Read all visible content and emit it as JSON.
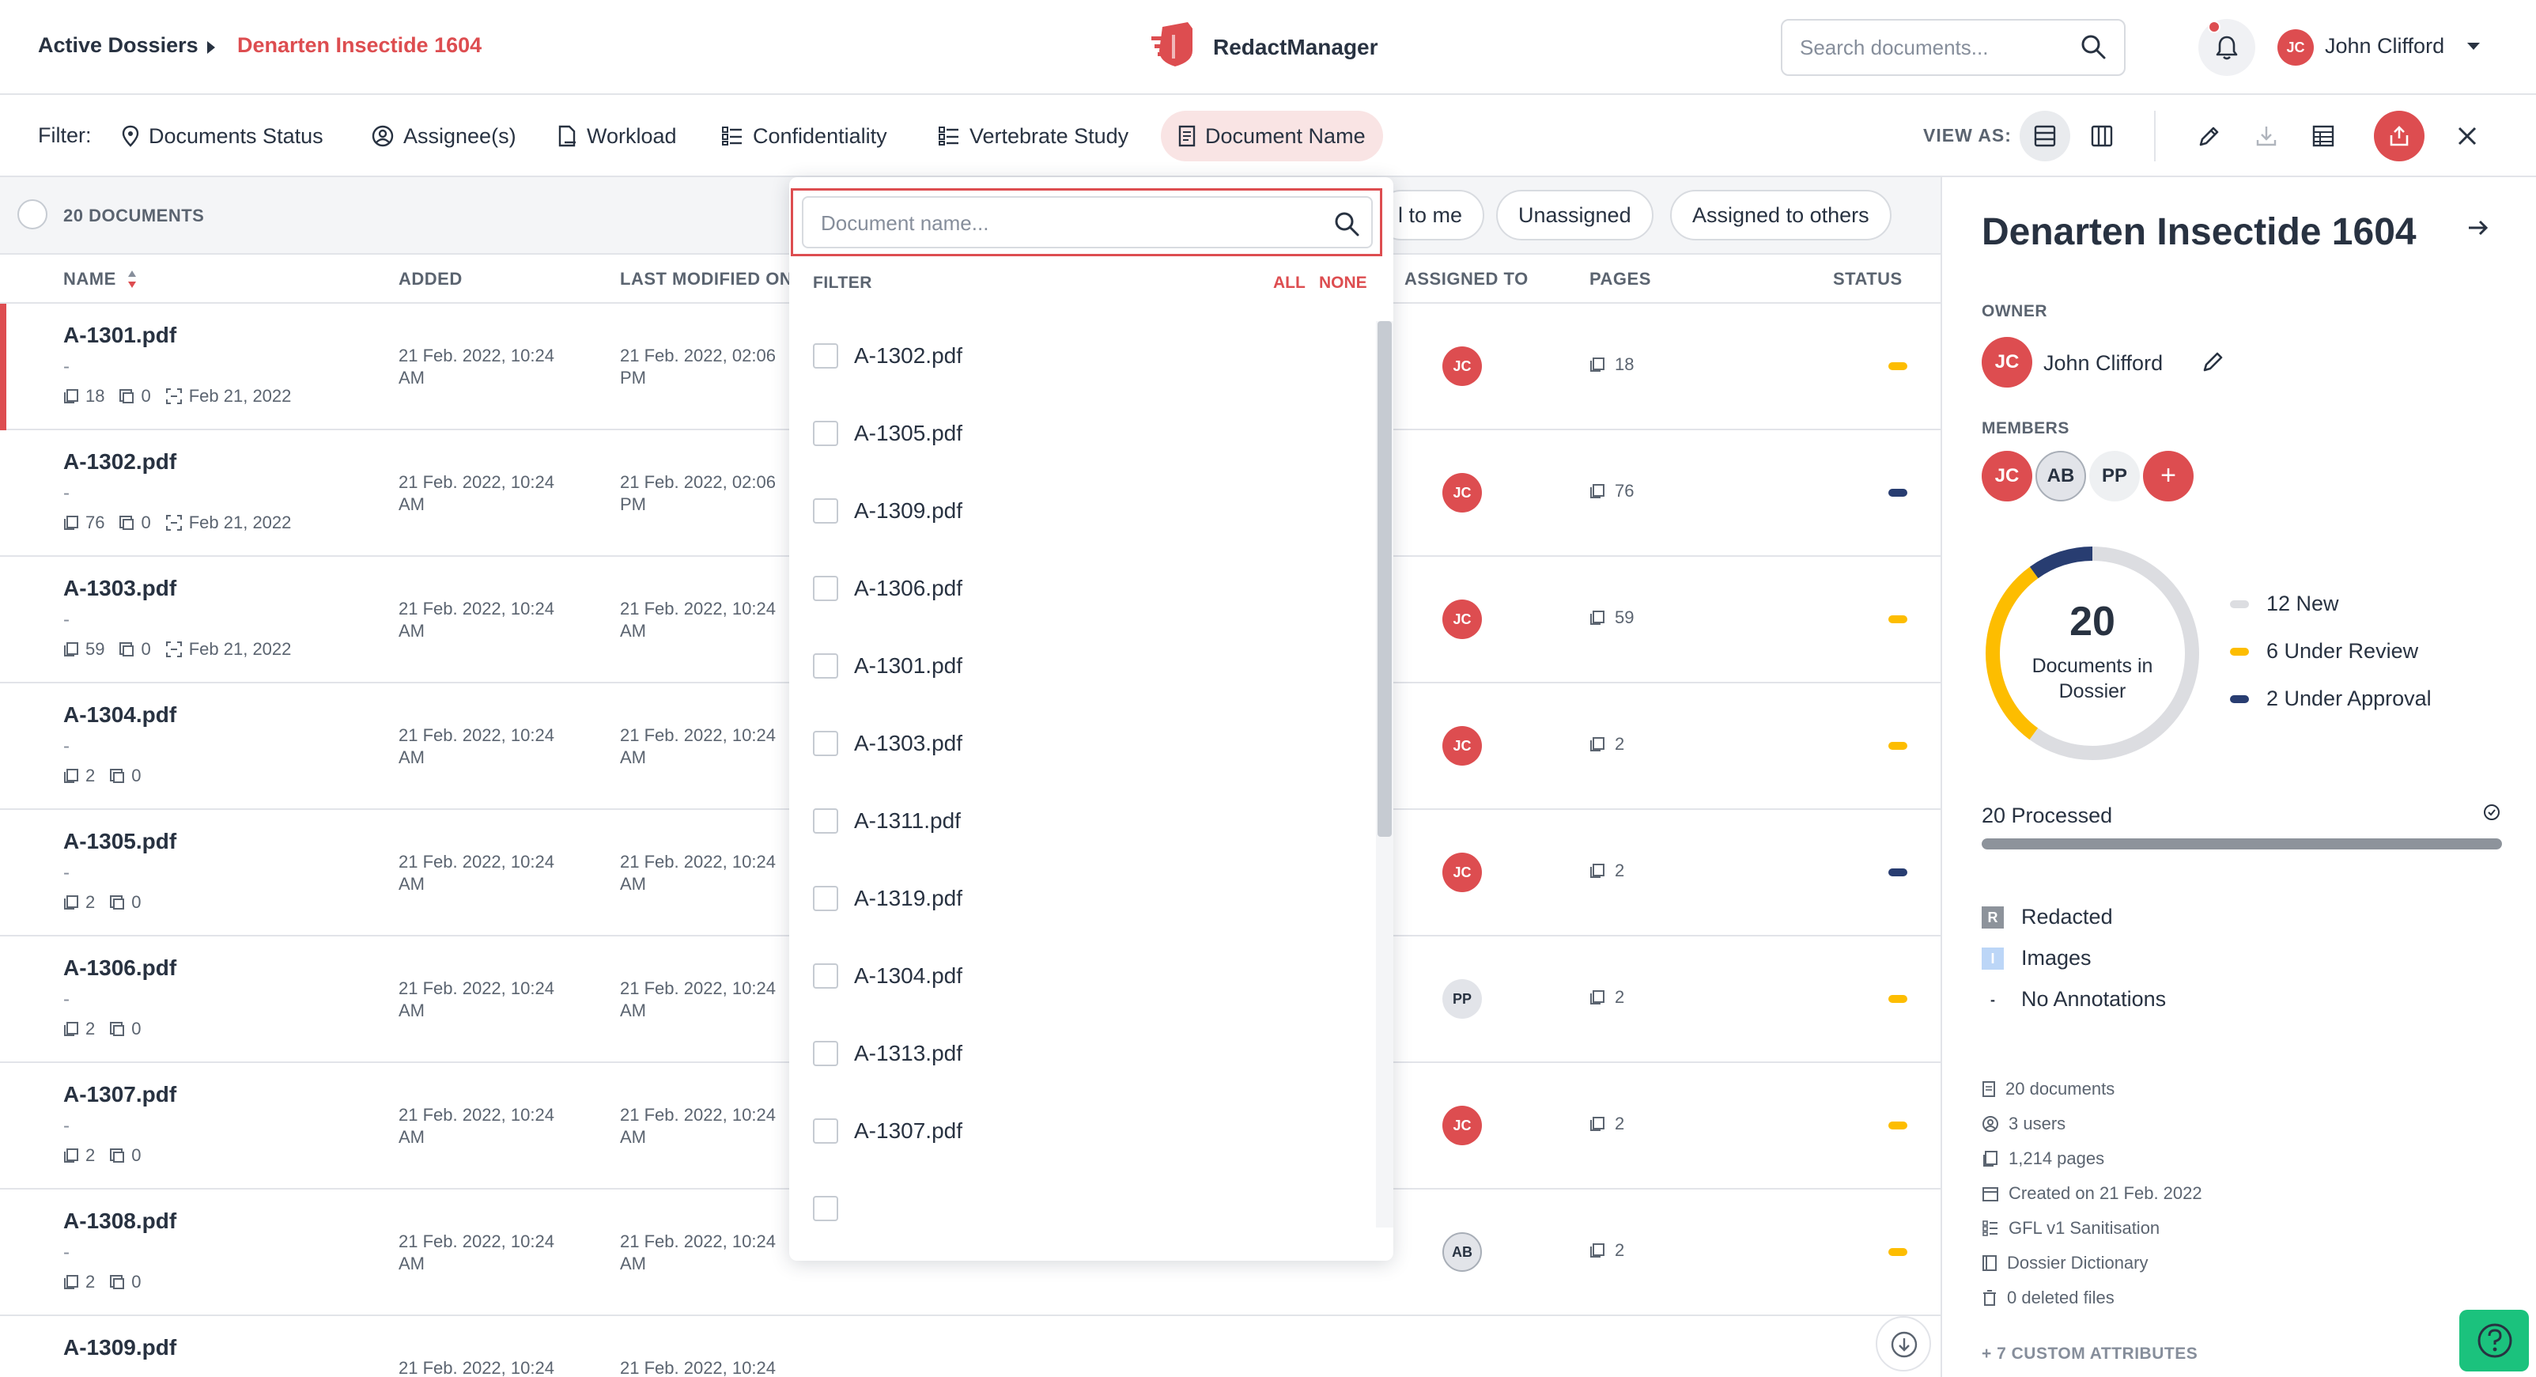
{
  "header": {
    "breadcrumb": [
      "Active Dossiers",
      "Denarten Insectide 1604"
    ],
    "app_name": "RedactManager",
    "search_placeholder": "Search documents...",
    "user": {
      "initials": "JC",
      "name": "John Clifford"
    }
  },
  "filterbar": {
    "label": "Filter:",
    "filters": [
      "Documents Status",
      "Assignee(s)",
      "Workload",
      "Confidentiality",
      "Vertebrate Study",
      "Document Name"
    ],
    "active_filter": "Document Name",
    "view_as_label": "VIEW AS:"
  },
  "table": {
    "doc_count": "20 DOCUMENTS",
    "chips": [
      "l to me",
      "Unassigned",
      "Assigned to others"
    ],
    "columns": {
      "name": "NAME",
      "added": "ADDED",
      "modified": "LAST MODIFIED ON",
      "assigned": "ASSIGNED TO",
      "pages": "PAGES",
      "status": "STATUS"
    },
    "rows": [
      {
        "name": "A-1301.pdf",
        "dash": "-",
        "meta_pages": "18",
        "meta_count": "0",
        "meta_date": "Feb 21, 2022",
        "added": "21 Feb. 2022, 10:24 AM",
        "modified": "21 Feb. 2022, 02:06 PM",
        "assignee": "JC",
        "pages": "18",
        "status": "Under Review"
      },
      {
        "name": "A-1302.pdf",
        "dash": "-",
        "meta_pages": "76",
        "meta_count": "0",
        "meta_date": "Feb 21, 2022",
        "added": "21 Feb. 2022, 10:24 AM",
        "modified": "21 Feb. 2022, 02:06 PM",
        "assignee": "JC",
        "pages": "76",
        "status": "Under Approval"
      },
      {
        "name": "A-1303.pdf",
        "dash": "-",
        "meta_pages": "59",
        "meta_count": "0",
        "meta_date": "Feb 21, 2022",
        "added": "21 Feb. 2022, 10:24 AM",
        "modified": "21 Feb. 2022, 10:24 AM",
        "assignee": "JC",
        "pages": "59",
        "status": "Under Review"
      },
      {
        "name": "A-1304.pdf",
        "dash": "-",
        "meta_pages": "2",
        "meta_count": "0",
        "meta_date": "",
        "added": "21 Feb. 2022, 10:24 AM",
        "modified": "21 Feb. 2022, 10:24 AM",
        "assignee": "JC",
        "pages": "2",
        "status": "Under Review"
      },
      {
        "name": "A-1305.pdf",
        "dash": "-",
        "meta_pages": "2",
        "meta_count": "0",
        "meta_date": "",
        "added": "21 Feb. 2022, 10:24 AM",
        "modified": "21 Feb. 2022, 10:24 AM",
        "assignee": "JC",
        "pages": "2",
        "status": "Under Approval"
      },
      {
        "name": "A-1306.pdf",
        "dash": "-",
        "meta_pages": "2",
        "meta_count": "0",
        "meta_date": "",
        "added": "21 Feb. 2022, 10:24 AM",
        "modified": "21 Feb. 2022, 10:24 AM",
        "assignee": "PP",
        "pages": "2",
        "status": "Under Review"
      },
      {
        "name": "A-1307.pdf",
        "dash": "-",
        "meta_pages": "2",
        "meta_count": "0",
        "meta_date": "",
        "added": "21 Feb. 2022, 10:24 AM",
        "modified": "21 Feb. 2022, 10:24 AM",
        "assignee": "JC",
        "pages": "2",
        "status": "Under Review"
      },
      {
        "name": "A-1308.pdf",
        "dash": "-",
        "meta_pages": "2",
        "meta_count": "0",
        "meta_date": "",
        "added": "21 Feb. 2022, 10:24 AM",
        "modified": "21 Feb. 2022, 10:24 AM",
        "assignee": "AB",
        "pages": "2",
        "status": "Under Review"
      },
      {
        "name": "A-1309.pdf",
        "dash": "",
        "meta_pages": "",
        "meta_count": "",
        "meta_date": "",
        "added": "21 Feb. 2022, 10:24",
        "modified": "21 Feb. 2022, 10:24",
        "assignee": "",
        "pages": "",
        "status": ""
      }
    ]
  },
  "dropdown": {
    "search_placeholder": "Document name...",
    "filter_label": "FILTER",
    "all_label": "ALL",
    "none_label": "NONE",
    "items": [
      "A-1302.pdf",
      "A-1305.pdf",
      "A-1309.pdf",
      "A-1306.pdf",
      "A-1301.pdf",
      "A-1303.pdf",
      "A-1311.pdf",
      "A-1319.pdf",
      "A-1304.pdf",
      "A-1313.pdf",
      "A-1307.pdf"
    ]
  },
  "panel": {
    "title": "Denarten Insectide 1604",
    "owner_label": "OWNER",
    "owner": {
      "initials": "JC",
      "name": "John Clifford"
    },
    "members_label": "MEMBERS",
    "members": [
      "JC",
      "AB",
      "PP"
    ],
    "add_member": "+",
    "donut": {
      "total": "20",
      "label": "Documents in Dossier",
      "segments": [
        {
          "label": "12 New",
          "value": 12,
          "color": "#dcdde1"
        },
        {
          "label": "6 Under Review",
          "value": 6,
          "color": "#fdbd00"
        },
        {
          "label": "2 Under Approval",
          "value": 2,
          "color": "#283d71"
        }
      ]
    },
    "processed_label": "20 Processed",
    "processed_fraction": 1.0,
    "annotations": [
      {
        "box": "R",
        "label": "Redacted"
      },
      {
        "box": "I",
        "label": "Images"
      },
      {
        "box": "-",
        "label": "No Annotations"
      }
    ],
    "stats": [
      "20 documents",
      "3 users",
      "1,214 pages",
      "Created on 21 Feb. 2022",
      "GFL v1 Sanitisation",
      "Dossier Dictionary",
      "0 deleted files"
    ],
    "custom_attrs": "+ 7 CUSTOM ATTRIBUTES"
  },
  "colors": {
    "accent": "#dd4d50",
    "review": "#fdbd00",
    "approval": "#283d71",
    "help": "#1bc27d"
  }
}
